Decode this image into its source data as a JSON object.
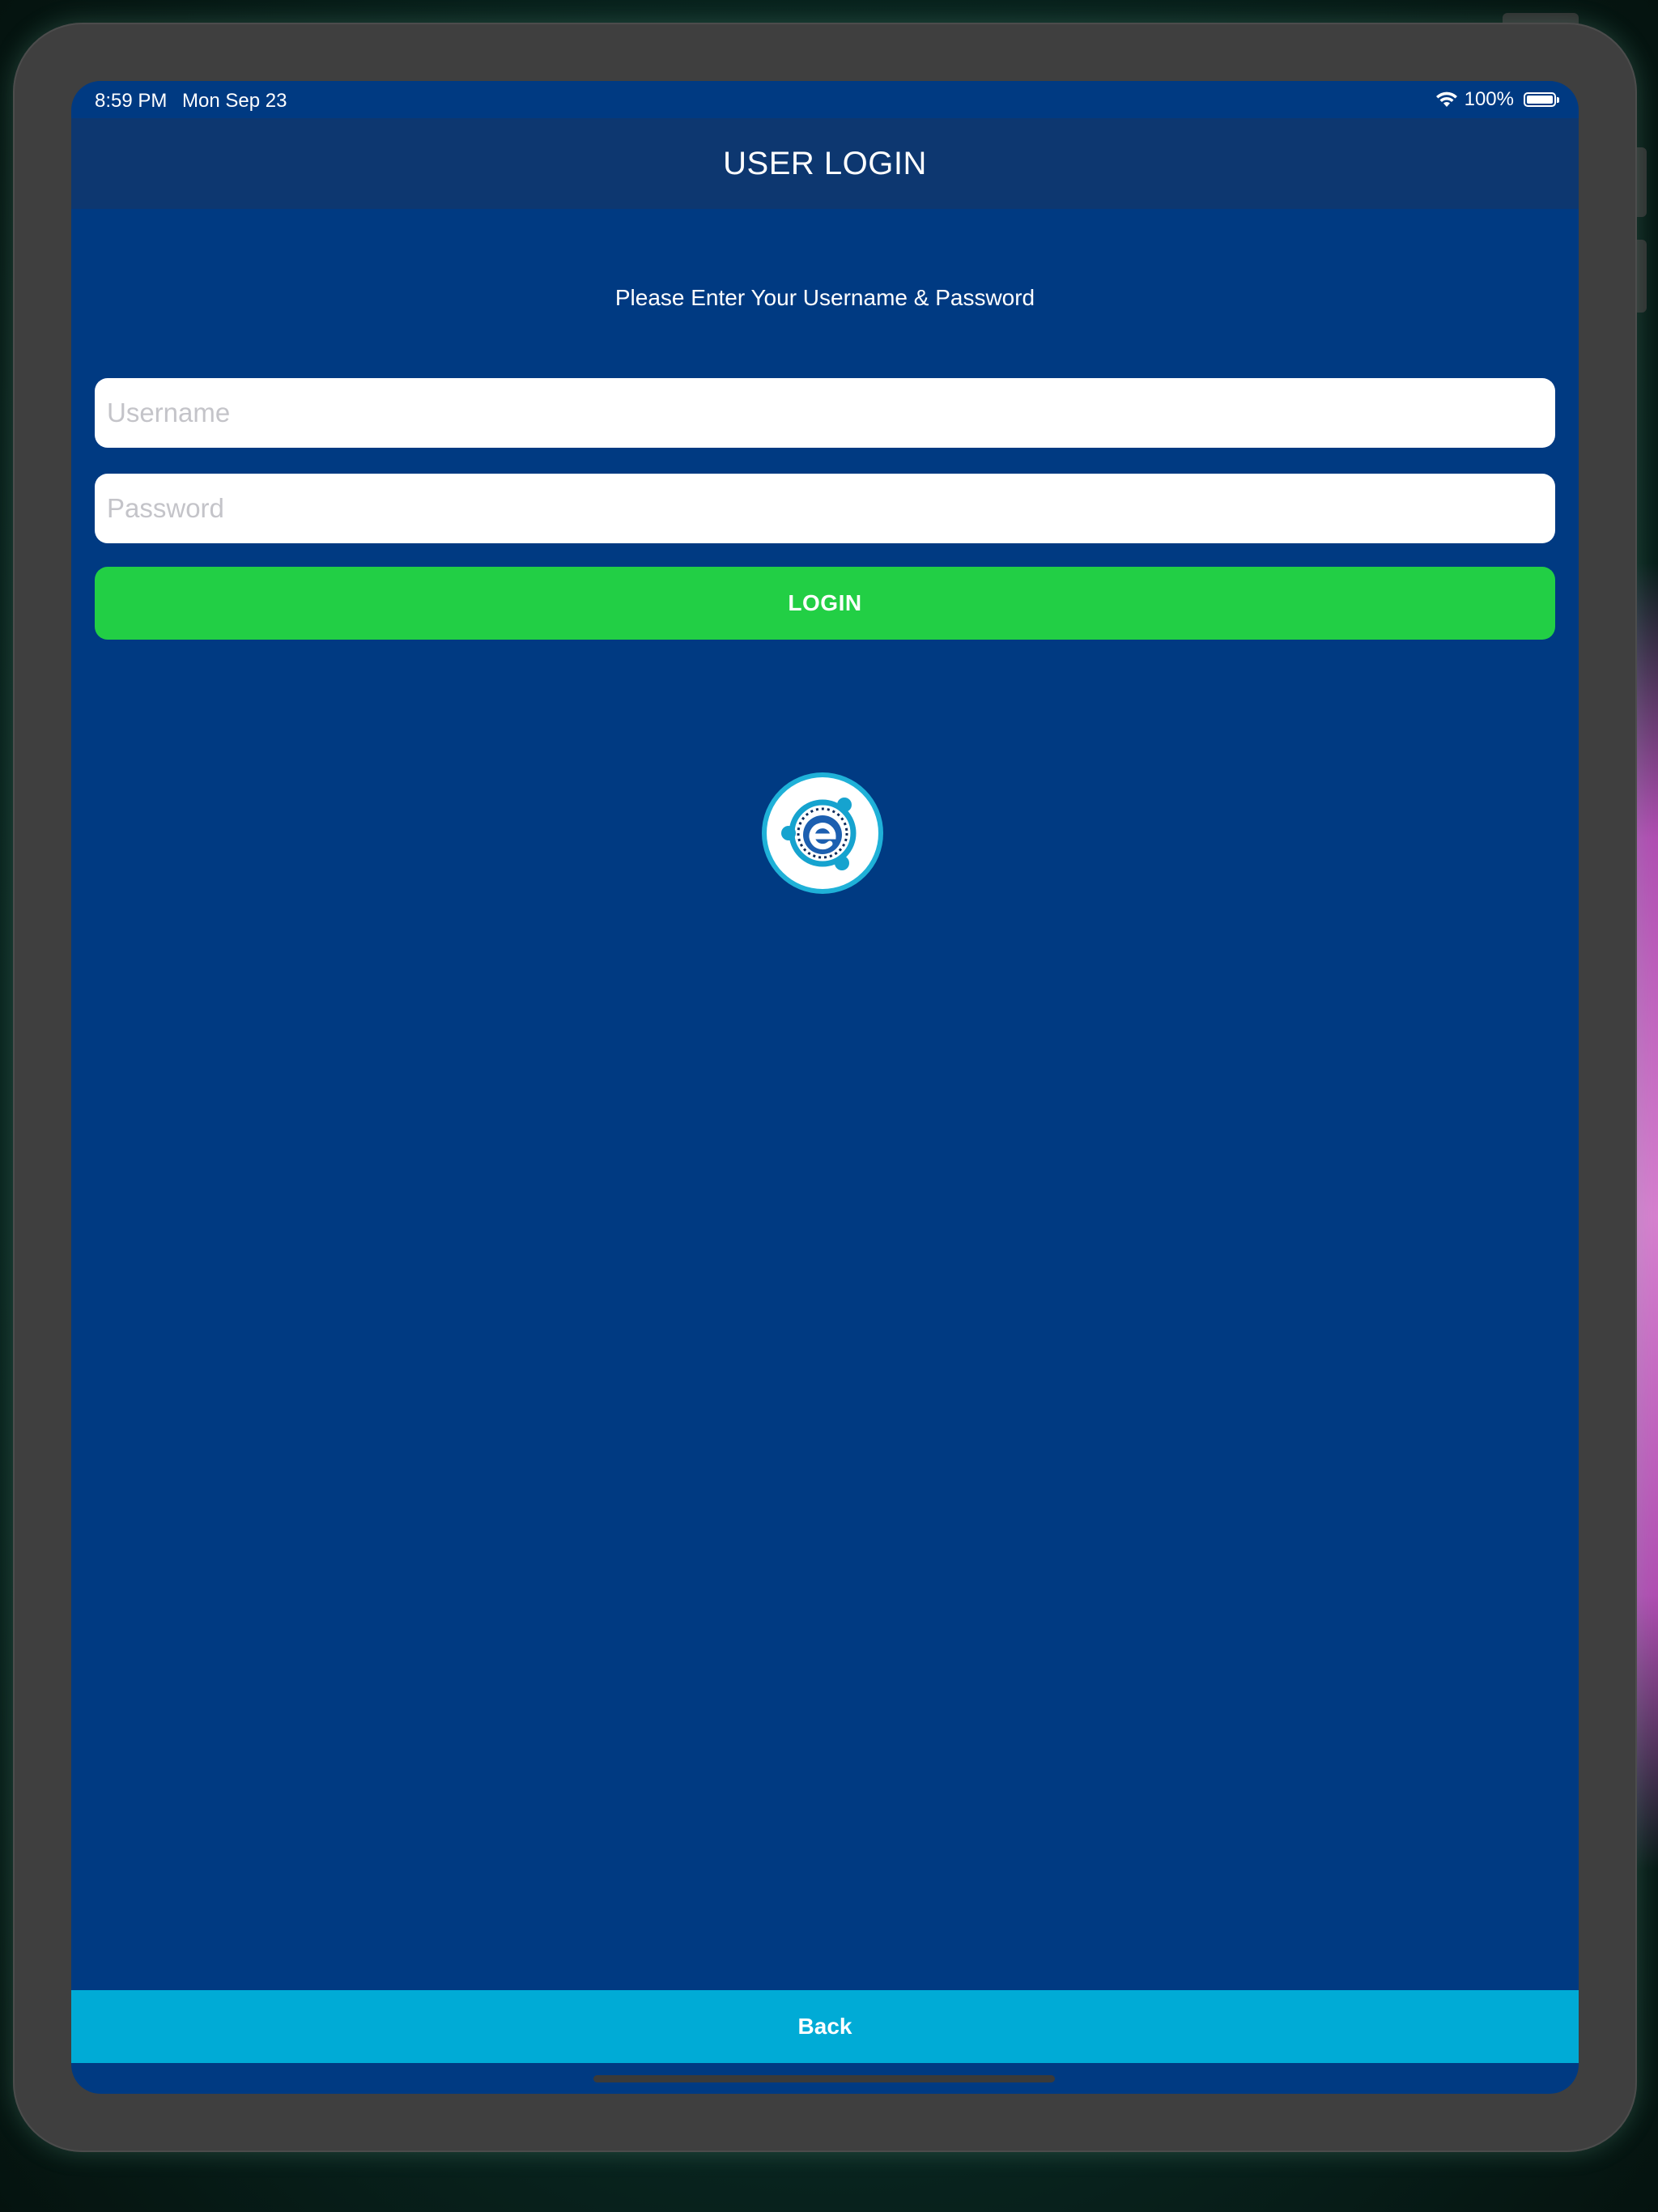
{
  "status_bar": {
    "time": "8:59 PM",
    "date": "Mon Sep 23",
    "battery_percent": "100%",
    "icons": [
      "wifi-icon",
      "battery-icon"
    ]
  },
  "nav": {
    "title": "USER LOGIN"
  },
  "form": {
    "instruction": "Please Enter Your Username & Password",
    "username": {
      "value": "",
      "placeholder": "Username"
    },
    "password": {
      "value": "",
      "placeholder": "Password"
    },
    "login_label": "LOGIN"
  },
  "logo": {
    "icon": "company-logo"
  },
  "footer": {
    "back_label": "Back"
  },
  "colors": {
    "background": "#003a82",
    "nav_bar": "#0d3770",
    "login_button": "#22cf45",
    "back_bar": "#00abd6",
    "device_frame": "#3f3f3f"
  }
}
